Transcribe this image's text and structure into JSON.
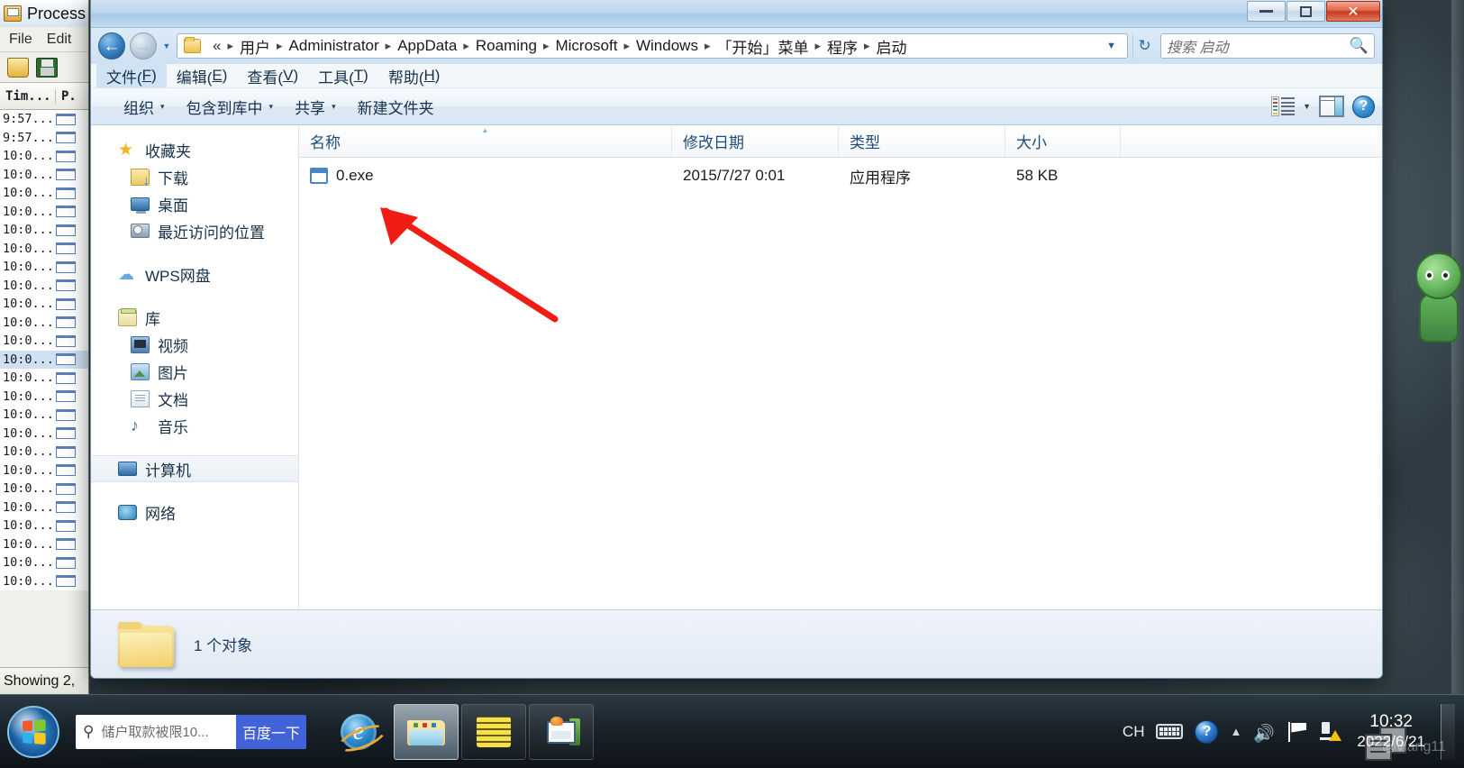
{
  "background_app": {
    "title": "Process",
    "menus": [
      "File",
      "Edit"
    ],
    "toolbar_icons": [
      "open-folder-icon",
      "save-icon"
    ],
    "columns": [
      "Tim...",
      "P."
    ],
    "rows": [
      "9:57...",
      "9:57...",
      "10:0...",
      "10:0...",
      "10:0...",
      "10:0...",
      "10:0...",
      "10:0...",
      "10:0...",
      "10:0...",
      "10:0...",
      "10:0...",
      "10:0...",
      "10:0...",
      "10:0...",
      "10:0...",
      "10:0...",
      "10:0...",
      "10:0...",
      "10:0...",
      "10:0...",
      "10:0...",
      "10:0...",
      "10:0...",
      "10:0...",
      "10:0..."
    ],
    "selected_row_index": 13,
    "status": "Showing 2,"
  },
  "explorer": {
    "window_buttons": {
      "minimize": "minimize-icon",
      "maximize": "maximize-icon",
      "close": "✕"
    },
    "address": {
      "ellipsis": "«",
      "crumbs": [
        "用户",
        "Administrator",
        "AppData",
        "Roaming",
        "Microsoft",
        "Windows",
        "「开始」菜单",
        "程序",
        "启动"
      ],
      "separator": "▸",
      "dropdown_caret": "▼",
      "refresh_icon": "↻"
    },
    "search": {
      "placeholder": "搜索 启动",
      "icon": "search-icon"
    },
    "menubar": [
      {
        "label": "文件",
        "accel": "F",
        "active": true
      },
      {
        "label": "编辑",
        "accel": "E",
        "active": false
      },
      {
        "label": "查看",
        "accel": "V",
        "active": false
      },
      {
        "label": "工具",
        "accel": "T",
        "active": false
      },
      {
        "label": "帮助",
        "accel": "H",
        "active": false
      }
    ],
    "toolbar": {
      "organize": "组织",
      "include_in_library": "包含到库中",
      "share": "共享",
      "new_folder": "新建文件夹",
      "caret": "▾",
      "view_icon": "view-layout-icon",
      "view_caret": "▼",
      "preview_icon": "preview-pane-icon",
      "help_icon": "?"
    },
    "navpane": [
      {
        "label": "收藏夹",
        "icon": "star-icon",
        "level": 1,
        "selected": false
      },
      {
        "label": "下载",
        "icon": "downloads-folder-icon",
        "level": 2,
        "selected": false
      },
      {
        "label": "桌面",
        "icon": "desktop-icon",
        "level": 2,
        "selected": false
      },
      {
        "label": "最近访问的位置",
        "icon": "recent-places-icon",
        "level": 2,
        "selected": false
      },
      {
        "label": "WPS网盘",
        "icon": "cloud-icon",
        "level": 1,
        "selected": false
      },
      {
        "label": "库",
        "icon": "library-icon",
        "level": 1,
        "selected": false
      },
      {
        "label": "视频",
        "icon": "video-icon",
        "level": 2,
        "selected": false
      },
      {
        "label": "图片",
        "icon": "pictures-icon",
        "level": 2,
        "selected": false
      },
      {
        "label": "文档",
        "icon": "documents-icon",
        "level": 2,
        "selected": false
      },
      {
        "label": "音乐",
        "icon": "music-icon",
        "level": 2,
        "selected": false
      },
      {
        "label": "计算机",
        "icon": "computer-icon",
        "level": 1,
        "selected": true
      },
      {
        "label": "网络",
        "icon": "network-icon",
        "level": 1,
        "selected": false
      }
    ],
    "columns": [
      {
        "label": "名称",
        "sorted": true
      },
      {
        "label": "修改日期",
        "sorted": false
      },
      {
        "label": "类型",
        "sorted": false
      },
      {
        "label": "大小",
        "sorted": false
      }
    ],
    "files": [
      {
        "name": "0.exe",
        "modified": "2015/7/27 0:01",
        "type": "应用程序",
        "size": "58 KB",
        "icon": "exe-file-icon"
      }
    ],
    "details": {
      "icon": "folder-icon",
      "text": "1 个对象"
    }
  },
  "taskbar": {
    "start_label": "start-orb",
    "baidu": {
      "query": "储户取款被限10...",
      "placeholder": "储户取款被限10...",
      "button": "百度一下",
      "search_icon": "search-icon"
    },
    "apps": [
      {
        "name": "internet-explorer",
        "label": "e",
        "active": false
      },
      {
        "name": "windows-explorer",
        "label": "",
        "active": true
      },
      {
        "name": "process-monitor",
        "label": "",
        "active": false
      },
      {
        "name": "notes-app",
        "label": "",
        "active": false
      }
    ],
    "tray": {
      "ime": "CH",
      "keyboard_icon": "keyboard-icon",
      "help_icon": "?",
      "expand_icon": "▲",
      "volume_icon": "speaker-icon",
      "flag_icon": "flag-icon",
      "action_center_icon": "action-center-warning-icon"
    },
    "clock": {
      "time": "10:32",
      "date": "2022/6/21"
    },
    "watermark": "@vlang11"
  }
}
